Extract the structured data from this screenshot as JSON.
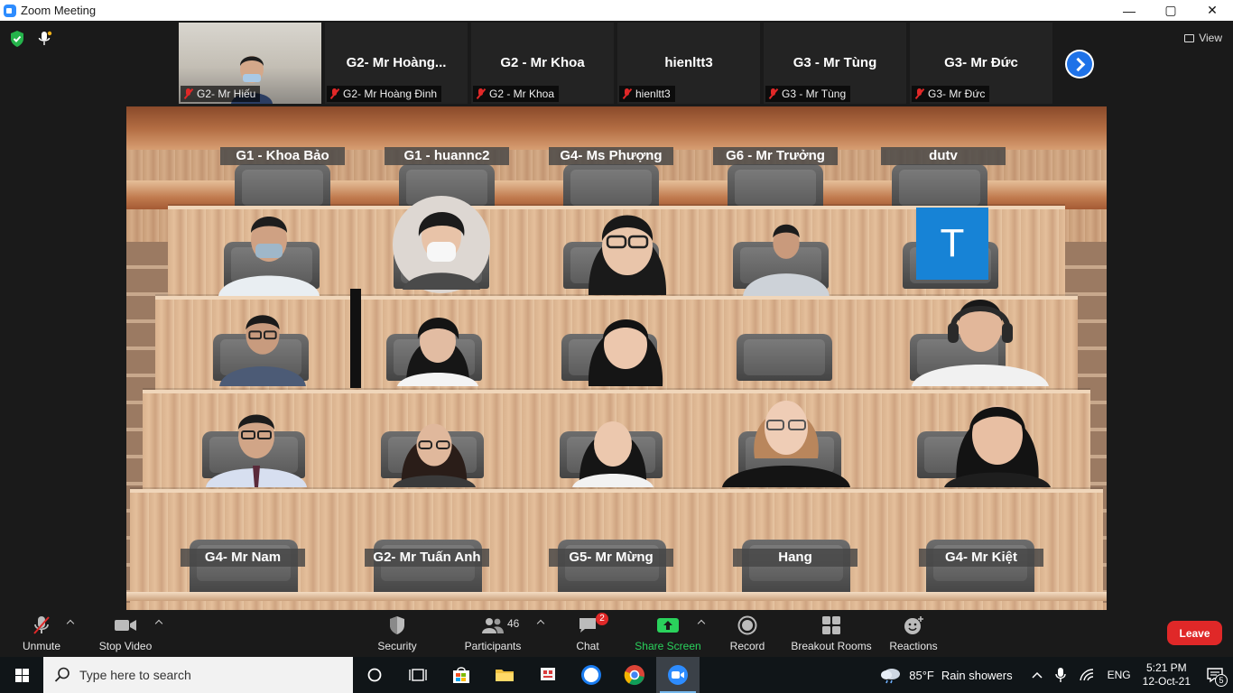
{
  "window": {
    "title": "Zoom Meeting",
    "controls": [
      "—",
      "▢",
      "✕"
    ]
  },
  "view_label": "View",
  "strip": [
    {
      "big": "",
      "tag": "G2- Mr Hiếu",
      "video": true
    },
    {
      "big": "G2- Mr Hoàng...",
      "tag": "G2- Mr Hoàng Đinh",
      "video": false
    },
    {
      "big": "G2 - Mr Khoa",
      "tag": "G2 - Mr Khoa",
      "video": false
    },
    {
      "big": "hienltt3",
      "tag": "hienltt3",
      "video": false
    },
    {
      "big": "G3 - Mr Tùng",
      "tag": "G3 - Mr Tùng",
      "video": false
    },
    {
      "big": "G3- Mr Đức",
      "tag": "G3- Mr Đức",
      "video": false
    }
  ],
  "scene": {
    "top_labels": [
      "G1 - Khoa Bảo",
      "G1 - huannc2",
      "G4- Ms Phượng",
      "G6 - Mr Trưởng",
      "dutv"
    ],
    "bottom_labels": [
      "G4- Mr Nam",
      "G2- Mr Tuấn Anh",
      "G5- Mr Mừng",
      "Hang",
      "G4- Mr Kiệt"
    ],
    "avatar_letter": "T"
  },
  "toolbar": {
    "unmute": "Unmute",
    "stop_video": "Stop Video",
    "security": "Security",
    "participants": "Participants",
    "participants_count": "46",
    "chat": "Chat",
    "chat_badge": "2",
    "share_screen": "Share Screen",
    "record": "Record",
    "breakout_rooms": "Breakout Rooms",
    "reactions": "Reactions",
    "leave": "Leave"
  },
  "taskbar": {
    "search_placeholder": "Type here to search",
    "weather_temp": "85°F",
    "weather_desc": "Rain showers",
    "lang": "ENG",
    "time": "5:21 PM",
    "date": "12-Oct-21",
    "notif_count": "5"
  },
  "colors": {
    "accent": "#2d8cff",
    "leave": "#e02828",
    "share": "#2ad25c",
    "avatar": "#1783d6"
  }
}
